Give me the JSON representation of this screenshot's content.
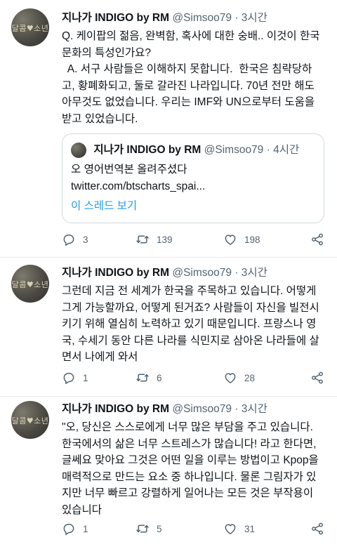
{
  "avatar_text": "달콤♥소년",
  "tweets": [
    {
      "name": "지나가 INDIGO by RM",
      "handle": "@Simsoo79 · 3시간",
      "lines": [
        "Q. 케이팝의 젊음, 완벽함, 혹사에 대한 숭배.. 이것이 한국",
        "문화의 특성인가요?",
        "  A. 서구 사람들은 이해하지 못합니다.  한국은 침략당하",
        "고, 황폐화되고, 둘로 갈라진 나라입니다. 70년 전만 해도",
        "아무것도 없었습니다. 우리는 IMF와 UN으로부터 도움을",
        "받고 있었습니다."
      ],
      "quote": {
        "name": "지나가 INDIGO by RM",
        "handle": "@Simsoo79 · 4시간",
        "line1": "오 영어번역본 올려주셨다",
        "link": "twitter.com/btscharts_spai...",
        "show_thread": "이 스레드 보기"
      },
      "replies": "3",
      "retweets": "139",
      "likes": "198"
    },
    {
      "name": "지나가 INDIGO by RM",
      "handle": "@Simsoo79 · 3시간",
      "lines": [
        "그런데 지금 전 세계가 한국을 주목하고 있습니다.  어떻게",
        "그게 가능할까요, 어떻게 된거죠? 사람들이 자신을 빌전시",
        "키기 위해 열심히 노력하고 있기 때문입니다.  프랑스나 영",
        "국, 수세기 동안 다른 나라를 식민지로 삼아온 나라들에 살",
        "면서 나에게 와서"
      ],
      "replies": "1",
      "retweets": "6",
      "likes": "28"
    },
    {
      "name": "지나가 INDIGO by RM",
      "handle": "@Simsoo79 · 3시간",
      "lines": [
        "\"오, 당신은 스스로에게 너무 많은 부담을 주고 있습니다.",
        "한국에서의 삶은 너무 스트레스가 많습니다! 라고 한다면,",
        "글쎄요 맞아요 그것은 어떤 일을 이루는 방법이고 Kpop을",
        "매력적으로 만드는 요소 중 하나입니다. 물론 그림자가 있",
        "지만 너무 빠르고 강렬하게 일어나는 모든 것은 부작용이",
        "있습니다"
      ],
      "replies": "1",
      "retweets": "5",
      "likes": "31"
    }
  ]
}
